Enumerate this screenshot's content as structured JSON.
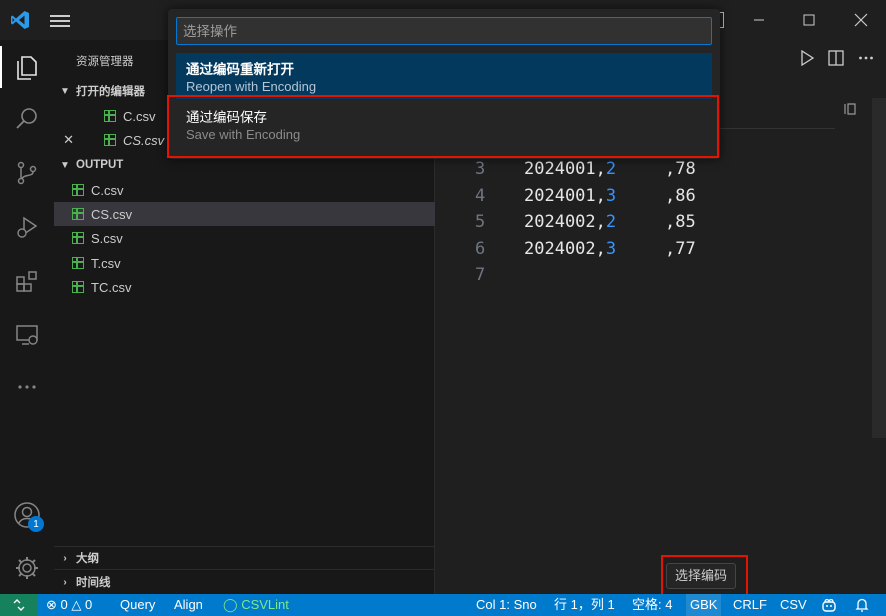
{
  "sidebar": {
    "title": "资源管理器",
    "open_editors_header": "打开的编辑器",
    "open_editors": [
      {
        "name": "C.csv"
      },
      {
        "name": "CS.csv"
      }
    ],
    "close_glyph": "✕",
    "output_header": "OUTPUT",
    "files": [
      "C.csv",
      "CS.csv",
      "S.csv",
      "T.csv",
      "TC.csv"
    ],
    "outline_header": "大纲",
    "timeline_header": "时间线"
  },
  "account_badge": "1",
  "editor": {
    "lines": [
      {
        "n": "3",
        "a": "2024001,",
        "b": "2",
        "c": ",78"
      },
      {
        "n": "4",
        "a": "2024001,",
        "b": "3",
        "c": ",86"
      },
      {
        "n": "5",
        "a": "2024002,",
        "b": "2",
        "c": ",85"
      },
      {
        "n": "6",
        "a": "2024002,",
        "b": "3",
        "c": ",77"
      },
      {
        "n": "7",
        "a": "",
        "b": "",
        "c": ""
      }
    ]
  },
  "palette": {
    "placeholder": "选择操作",
    "options": [
      {
        "title": "通过编码重新打开",
        "subtitle": "Reopen with Encoding"
      },
      {
        "title": "通过编码保存",
        "subtitle": "Save with Encoding"
      }
    ]
  },
  "statusbar": {
    "errors": "0",
    "warnings": "0",
    "query": "Query",
    "align": "Align",
    "csvlint": "CSVLint",
    "col": "Col 1: Sno",
    "position": "行 1，列 1",
    "spaces": "空格: 4",
    "encoding": "GBK",
    "eol": "CRLF",
    "language": "CSV"
  },
  "tooltip": "选择编码",
  "colors": {
    "accent": "#007acc",
    "highlight_box": "#e51400",
    "csv_icon": "#4caf50"
  }
}
